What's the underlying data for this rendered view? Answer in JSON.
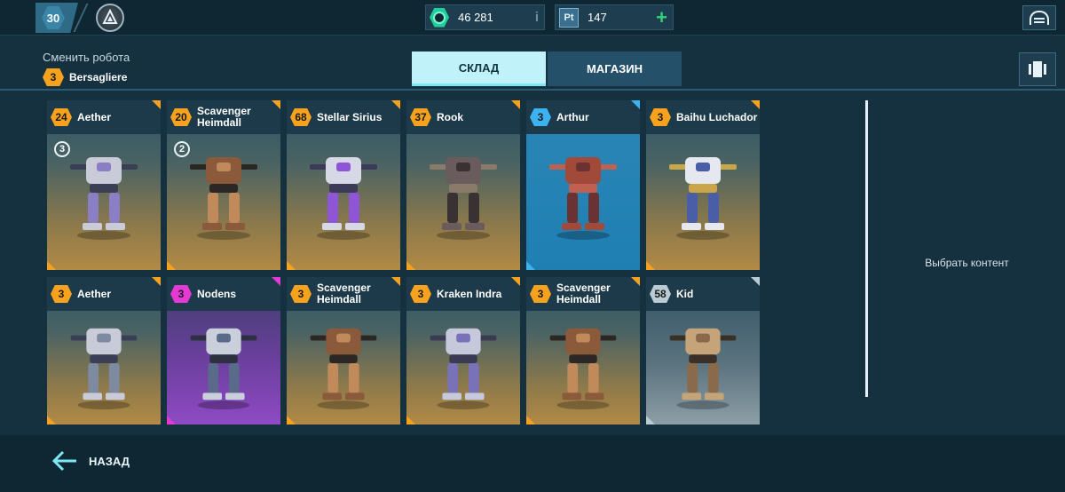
{
  "topbar": {
    "player_level": "30",
    "gold_value": "46 281",
    "platinum_label": "Pt",
    "platinum_value": "147"
  },
  "header": {
    "change_robot_title": "Сменить робота",
    "current_robot": {
      "level": "3",
      "name": "Bersagliere"
    },
    "tabs": [
      {
        "label": "СКЛАД",
        "active": true
      },
      {
        "label": "МАГАЗИН",
        "active": false
      }
    ]
  },
  "robots": [
    {
      "level": "24",
      "name": "Aether",
      "slot": "3",
      "rarity": "orange",
      "palette": [
        "#c9cbd8",
        "#8a7fc4",
        "#3a3f55"
      ]
    },
    {
      "level": "20",
      "name": "Scavenger Heimdall",
      "slot": "2",
      "rarity": "orange",
      "palette": [
        "#8a5a3a",
        "#c08a5a",
        "#2c2624"
      ]
    },
    {
      "level": "68",
      "name": "Stellar Sirius",
      "rarity": "orange",
      "palette": [
        "#d6d8e6",
        "#8e56d6",
        "#3c3a58"
      ]
    },
    {
      "level": "37",
      "name": "Rook",
      "rarity": "orange",
      "palette": [
        "#6a5c5c",
        "#3a3232",
        "#8a7a6a"
      ]
    },
    {
      "level": "3",
      "name": "Arthur",
      "rarity": "blue",
      "palette": [
        "#a24a3a",
        "#6a3232",
        "#c06050"
      ]
    },
    {
      "level": "3",
      "name": "Baihu Luchador",
      "rarity": "orange",
      "palette": [
        "#e6e8f0",
        "#4a5ea8",
        "#c9a64a"
      ]
    },
    {
      "level": "3",
      "name": "Aether",
      "rarity": "orange",
      "palette": [
        "#c9cbd8",
        "#7e8aa0",
        "#3a3f55"
      ]
    },
    {
      "level": "3",
      "name": "Nodens",
      "rarity": "magenta",
      "palette": [
        "#c9d0dc",
        "#5a6a8a",
        "#2c3040"
      ]
    },
    {
      "level": "3",
      "name": "Scavenger Heimdall",
      "rarity": "orange",
      "palette": [
        "#8a5a3a",
        "#c08a5a",
        "#2c2624"
      ]
    },
    {
      "level": "3",
      "name": "Kraken Indra",
      "rarity": "orange",
      "palette": [
        "#c6c8dc",
        "#7a72b8",
        "#3a3a52"
      ]
    },
    {
      "level": "3",
      "name": "Scavenger Heimdall",
      "rarity": "orange",
      "palette": [
        "#8a5a3a",
        "#c08a5a",
        "#2c2624"
      ]
    },
    {
      "level": "58",
      "name": "Kid",
      "rarity": "grey",
      "palette": [
        "#c6a47a",
        "#8a6a4a",
        "#3a3028"
      ]
    }
  ],
  "right_panel": {
    "placeholder": "Выбрать контент"
  },
  "footer": {
    "back_label": "НАЗАД"
  },
  "colors": {
    "orange": "#f6a21e",
    "blue": "#3cb2ef",
    "magenta": "#e43ad3",
    "grey": "#b9cbd3",
    "accent_tab": "#bff3f9",
    "background": "#15303f"
  },
  "icons": {
    "league": "league-emblem-icon",
    "gold": "gold-gem-icon",
    "platinum": "platinum-icon",
    "hangar": "hangar-icon",
    "view_toggle": "carousel-view-icon",
    "back": "back-arrow-icon"
  }
}
